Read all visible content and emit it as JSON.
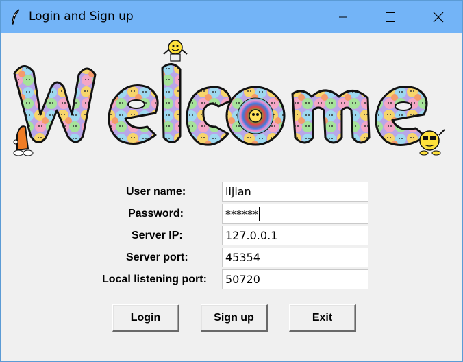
{
  "window": {
    "title": "Login and Sign up",
    "icon": "feather-icon"
  },
  "banner": {
    "text": "Welcome",
    "icon": "welcome-smiley-banner"
  },
  "form": {
    "fields": [
      {
        "label": "User name:",
        "value": "lijian"
      },
      {
        "label": "Password:",
        "value": "******"
      },
      {
        "label": "Server IP:",
        "value": "127.0.0.1"
      },
      {
        "label": "Server port:",
        "value": "45354"
      },
      {
        "label": "Local listening port:",
        "value": "50720"
      }
    ]
  },
  "buttons": {
    "login": "Login",
    "signup": "Sign up",
    "exit": "Exit"
  },
  "colors": {
    "titlebar": "#73b4f7",
    "window_bg": "#f0f0f0"
  }
}
